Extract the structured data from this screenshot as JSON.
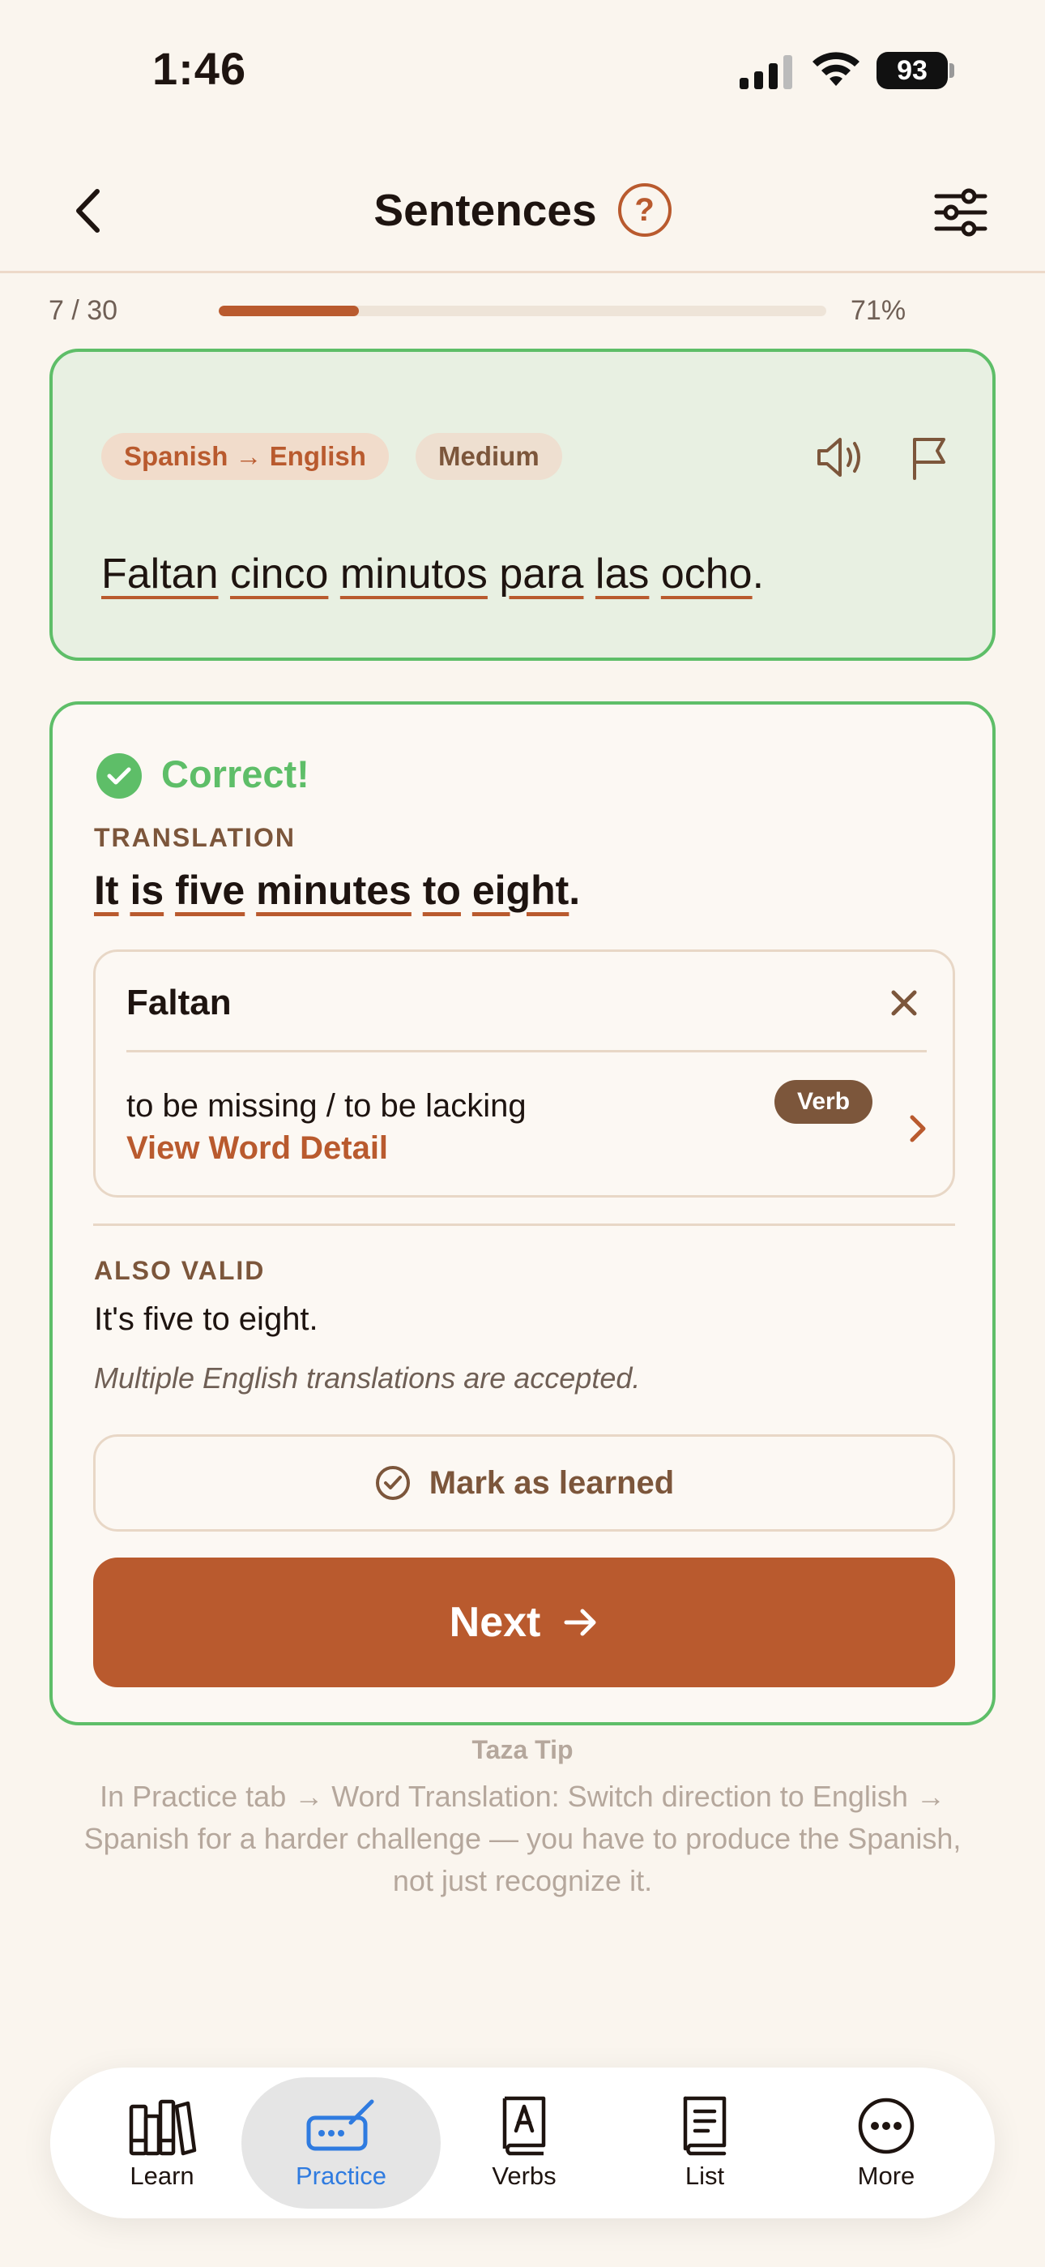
{
  "status": {
    "time": "1:46",
    "battery": "93"
  },
  "header": {
    "title": "Sentences",
    "help": "?"
  },
  "progress": {
    "count": "7 / 30",
    "percent": "71%",
    "fraction": 0.23
  },
  "prompt": {
    "direction_badge": "Spanish → English",
    "level_badge": "Medium",
    "words": [
      "Faltan",
      "cinco",
      "minutos",
      "para",
      "las",
      "ocho"
    ],
    "punct": "."
  },
  "result": {
    "status": "Correct!",
    "translation_label": "TRANSLATION",
    "translation_words": [
      "It",
      "is",
      "five",
      "minutes",
      "to",
      "eight"
    ],
    "translation_punct": "."
  },
  "word_detail": {
    "word": "Faltan",
    "definition": "to be missing / to be lacking",
    "pos": "Verb",
    "link": "View Word Detail"
  },
  "also_valid": {
    "label": "ALSO VALID",
    "text": "It's five to eight.",
    "note": "Multiple English translations are accepted."
  },
  "actions": {
    "mark_learned": "Mark as learned",
    "next": "Next"
  },
  "tip": {
    "title": "Taza Tip",
    "body": "In Practice tab → Word Translation: Switch direction to English → Spanish for a harder challenge — you have to produce the Spanish, not just recognize it."
  },
  "tabs": [
    {
      "label": "Learn",
      "icon": "books-icon"
    },
    {
      "label": "Practice",
      "icon": "keyboard-pen-icon",
      "active": true
    },
    {
      "label": "Verbs",
      "icon": "verb-book-icon"
    },
    {
      "label": "List",
      "icon": "list-book-icon"
    },
    {
      "label": "More",
      "icon": "more-icon"
    }
  ],
  "colors": {
    "accent": "#B95A2E",
    "success": "#5EBE68",
    "tab_active": "#2F7BE0"
  }
}
